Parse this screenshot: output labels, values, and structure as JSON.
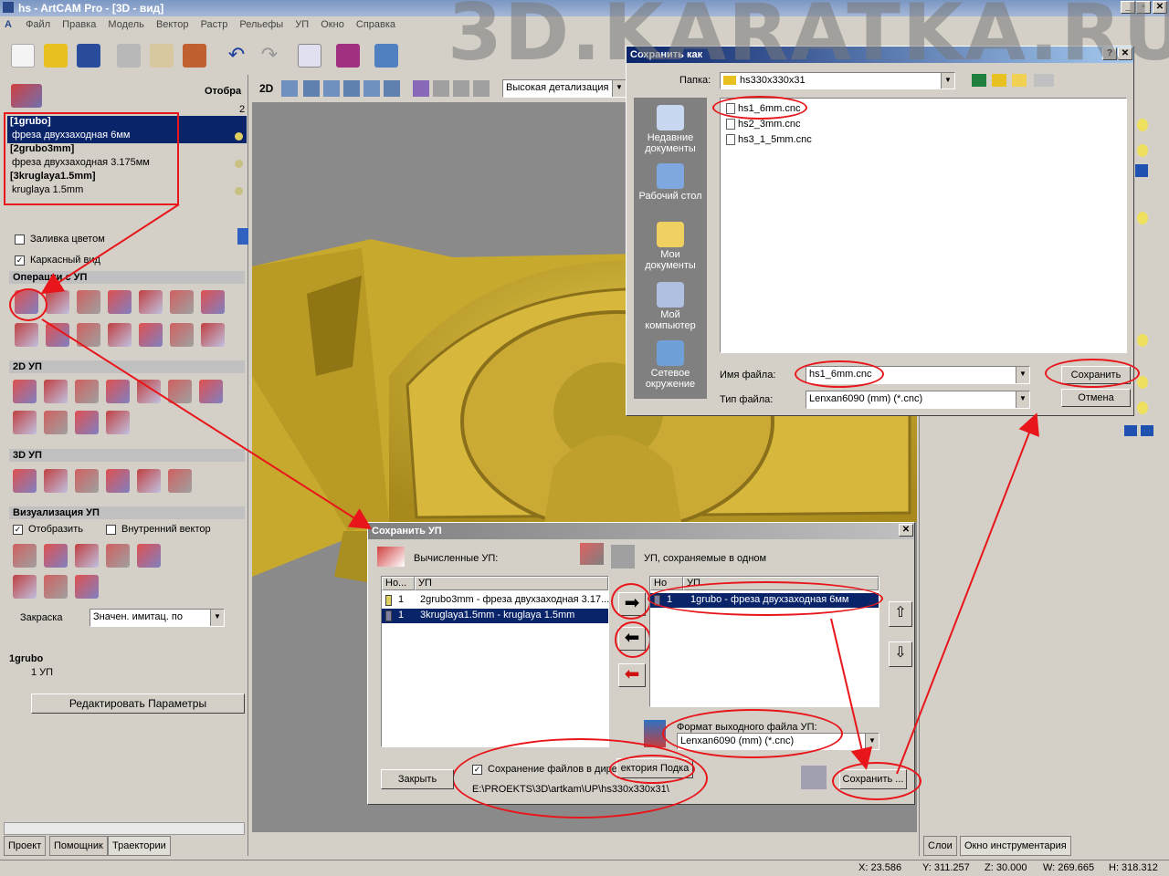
{
  "window": {
    "title": "hs - ArtCAM Pro - [3D - вид]"
  },
  "menu": [
    "Файл",
    "Правка",
    "Модель",
    "Вектор",
    "Растр",
    "Рельефы",
    "УП",
    "Окно",
    "Справка"
  ],
  "watermark": "3D.KARATKA.RU",
  "left_panel": {
    "display_label": "Отобра",
    "display_num": "2",
    "toolpaths": [
      {
        "name": "[1grubo]",
        "tool": "фреза двухзаходная 6мм"
      },
      {
        "name": "[2grubo3mm]",
        "tool": "фреза двухзаходная 3.175мм"
      },
      {
        "name": "[3kruglaya1.5mm]",
        "tool": "kruglaya 1.5mm"
      }
    ],
    "fill_color_label": "Заливка цветом",
    "wireframe_label": "Каркасный вид",
    "sections": {
      "operations": "Операции с УП",
      "toolpaths_2d": "2D УП",
      "toolpaths_3d": "3D УП",
      "visualization": "Визуализация УП"
    },
    "show_label": "Отобразить",
    "inner_vector_label": "Внутренний вектор",
    "shading_label": "Закраска",
    "shading_value": "Значен. имитац. по",
    "current_name": "1grubo",
    "current_count": "1 УП",
    "edit_params_button": "Редактировать Параметры"
  },
  "tabs": {
    "project": "Проект",
    "helper": "Помощник",
    "toolpaths": "Траектории",
    "layers": "Слои",
    "tool_window": "Окно инструментария"
  },
  "view_toolbar": {
    "mode": "2D",
    "detail": "Высокая детализация"
  },
  "save_as_dialog": {
    "title": "Сохранить как",
    "folder_label": "Папка:",
    "folder_value": "hs330x330x31",
    "places": [
      "Недавние документы",
      "Рабочий стол",
      "Мои документы",
      "Мой компьютер",
      "Сетевое окружение"
    ],
    "files": [
      "hs1_6mm.cnc",
      "hs2_3mm.cnc",
      "hs3_1_5mm.cnc"
    ],
    "filename_label": "Имя файла:",
    "filename_value": "hs1_6mm.cnc",
    "filetype_label": "Тип файла:",
    "filetype_value": "Lenxan6090 (mm) (*.cnc)",
    "save_button": "Сохранить",
    "cancel_button": "Отмена"
  },
  "save_tp_dialog": {
    "title": "Сохранить УП",
    "computed_label": "Вычисленные УП:",
    "saved_label": "УП, сохраняемые в одном",
    "col_no": "Но...",
    "col_tp": "УП",
    "col_no2": "Но",
    "left_rows": [
      {
        "no": "1",
        "tp": "2grubo3mm - фреза двухзаходная 3.17..."
      },
      {
        "no": "1",
        "tp": "3kruglaya1.5mm - kruglaya 1.5mm"
      }
    ],
    "right_rows": [
      {
        "no": "1",
        "tp": "1grubo - фреза двухзаходная 6мм"
      }
    ],
    "format_label": "Формат выходного файла УП:",
    "format_value": "Lenxan6090 (mm) (*.cnc)",
    "save_in_dir_label": "Сохранение файлов в дире",
    "dir_button": "ектория Подка",
    "path": "E:\\PROEKTS\\3D\\artkam\\UP\\hs330x330x31\\",
    "close_button": "Закрыть",
    "save_button": "Сохранить ..."
  },
  "status": {
    "x": "X: 23.586",
    "y": "Y: 311.257",
    "z": "Z: 30.000",
    "w": "W: 269.665",
    "h": "H: 318.312"
  }
}
